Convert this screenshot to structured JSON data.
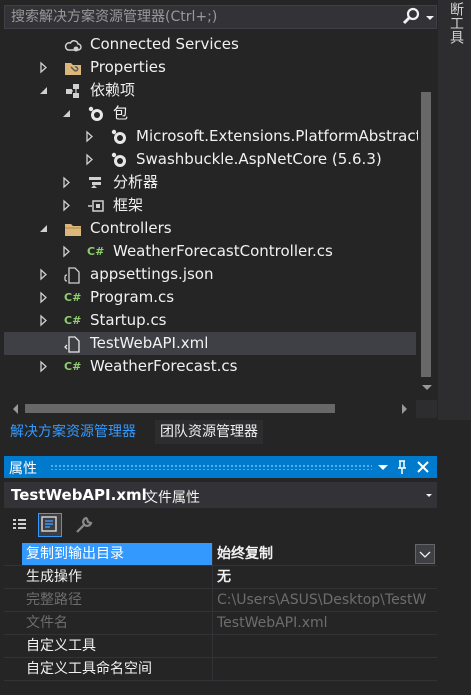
{
  "search": {
    "placeholder": "搜索解决方案资源管理器(Ctrl+;)"
  },
  "side_tab": {
    "label": "断工具"
  },
  "tree": {
    "items": [
      {
        "label": "Connected Services",
        "icon": "cloud-icon"
      },
      {
        "label": "Properties",
        "icon": "wrench-folder-icon"
      },
      {
        "label": "依赖项",
        "icon": "dependencies-icon"
      },
      {
        "label": "包",
        "icon": "package-icon"
      },
      {
        "label": "Microsoft.Extensions.PlatformAbstract",
        "icon": "package-icon"
      },
      {
        "label": "Swashbuckle.AspNetCore (5.6.3)",
        "icon": "package-icon"
      },
      {
        "label": "分析器",
        "icon": "analyzer-icon"
      },
      {
        "label": "框架",
        "icon": "framework-icon"
      },
      {
        "label": "Controllers",
        "icon": "folder-icon"
      },
      {
        "label": "WeatherForecastController.cs",
        "icon": "csharp-icon"
      },
      {
        "label": "appsettings.json",
        "icon": "json-file-icon"
      },
      {
        "label": "Program.cs",
        "icon": "csharp-icon"
      },
      {
        "label": "Startup.cs",
        "icon": "csharp-icon"
      },
      {
        "label": "TestWebAPI.xml",
        "icon": "xml-file-icon"
      },
      {
        "label": "WeatherForecast.cs",
        "icon": "csharp-icon"
      }
    ],
    "csharp_glyph": "C#"
  },
  "bottom_tabs": {
    "solution": "解决方案资源管理器",
    "team": "团队资源管理器"
  },
  "properties": {
    "title": "属性",
    "object_name": "TestWebAPI.xml",
    "object_type": "文件属性",
    "rows": [
      {
        "name": "复制到输出目录",
        "value": "始终复制"
      },
      {
        "name": "生成操作",
        "value": "无"
      },
      {
        "name": "完整路径",
        "value": "C:\\Users\\ASUS\\Desktop\\TestW"
      },
      {
        "name": "文件名",
        "value": "TestWebAPI.xml"
      },
      {
        "name": "自定义工具",
        "value": ""
      },
      {
        "name": "自定义工具命名空间",
        "value": ""
      }
    ]
  },
  "colors": {
    "accent": "#007acc",
    "selection": "#3399ff",
    "csharp": "#68217a",
    "background": "#252526"
  }
}
